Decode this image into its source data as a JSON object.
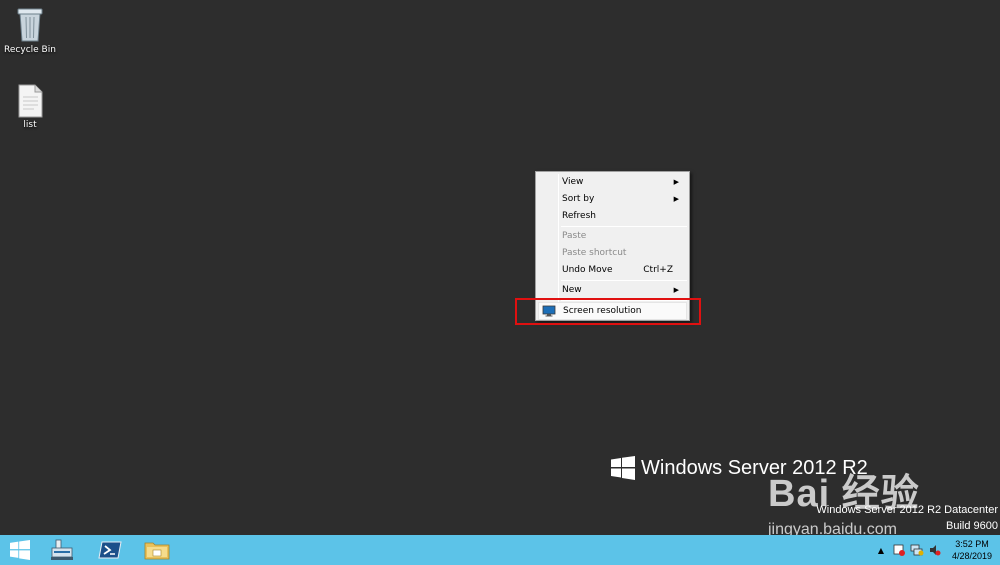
{
  "desktop": {
    "icons": [
      {
        "label": "Recycle Bin",
        "icon": "recycle-bin-icon"
      },
      {
        "label": "list",
        "icon": "text-file-icon"
      }
    ]
  },
  "context_menu": {
    "items": [
      {
        "label": "View",
        "submenu": true
      },
      {
        "label": "Sort by",
        "submenu": true
      },
      {
        "label": "Refresh"
      },
      {
        "label": "Paste",
        "disabled": true
      },
      {
        "label": "Paste shortcut",
        "disabled": true
      },
      {
        "label": "Undo Move",
        "shortcut": "Ctrl+Z"
      },
      {
        "label": "New",
        "submenu": true
      },
      {
        "label": "Screen resolution",
        "icon": "monitor-icon",
        "highlighted": true
      }
    ],
    "highlight_color": "#e01010"
  },
  "branding": {
    "product": "Windows Server 2012 R2",
    "edition": "Windows Server 2012 R2 Datacenter",
    "build": "Build 9600"
  },
  "watermark": {
    "line1": "Bai 经验",
    "line2": "jingyan.baidu.com"
  },
  "taskbar": {
    "buttons": [
      "start-icon",
      "server-manager-icon",
      "powershell-icon",
      "file-explorer-icon"
    ],
    "clock": {
      "time": "3:52 PM",
      "date": "4/28/2019"
    },
    "color": "#5cc3e8"
  }
}
